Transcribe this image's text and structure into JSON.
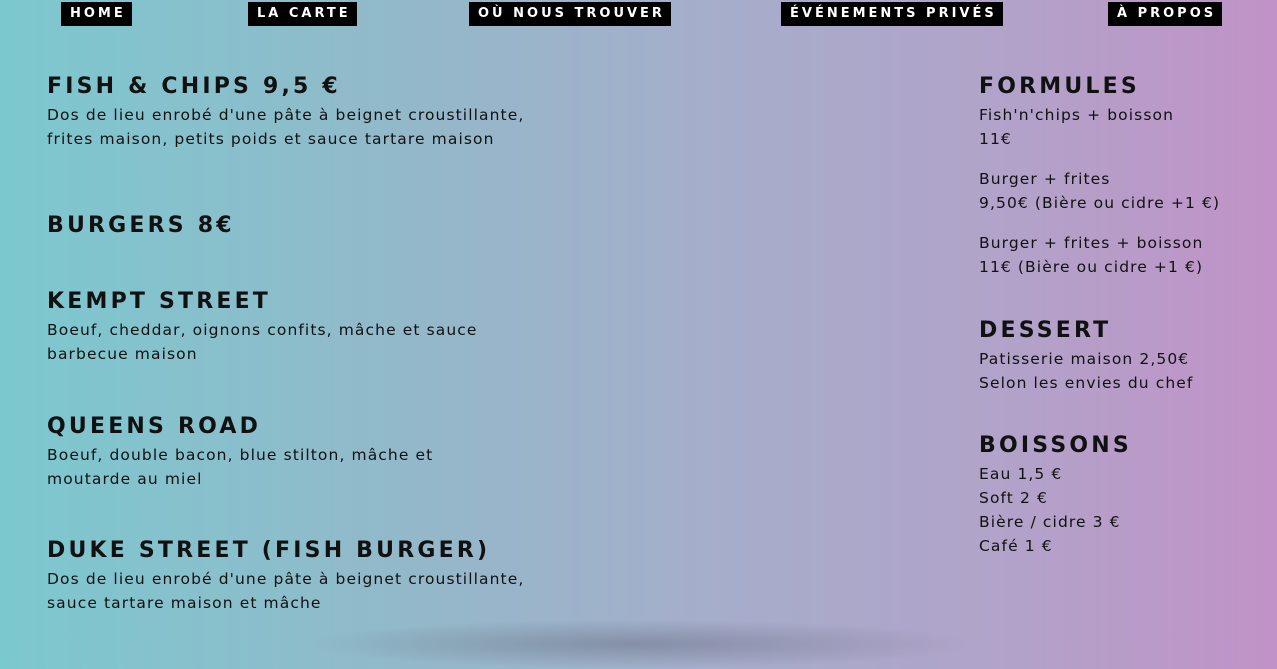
{
  "nav": {
    "home": "HOME",
    "carte": "LA CARTE",
    "trouver": "OÙ NOUS TROUVER",
    "events": "ÉVÉNEMENTS PRIVÉS",
    "propos": "À PROPOS"
  },
  "menu": {
    "fish": {
      "title": "FISH & CHIPS 9,5 €",
      "desc": "Dos de lieu enrobé d'une pâte à beignet croustillante, frites maison, petits poids et sauce tartare maison"
    },
    "burgers": {
      "title": "BURGERS 8€"
    },
    "kempt": {
      "title": "KEMPT STREET",
      "desc": "Boeuf, cheddar, oignons confits, mâche et sauce barbecue maison"
    },
    "queens": {
      "title": "QUEENS ROAD",
      "desc": "Boeuf, double bacon, blue stilton, mâche et moutarde au miel"
    },
    "duke": {
      "title": "DUKE STREET (FISH BURGER)",
      "desc": "Dos de lieu enrobé d'une pâte à beignet croustillante, sauce tartare maison et mâche"
    }
  },
  "formules": {
    "title": "FORMULES",
    "groups": [
      {
        "line1": "Fish'n'chips + boisson",
        "line2": "11€"
      },
      {
        "line1": "Burger + frites",
        "line2": "9,50€ (Bière ou cidre +1 €)"
      },
      {
        "line1": "Burger + frites + boisson",
        "line2": "11€ (Bière ou cidre +1 €)"
      }
    ]
  },
  "dessert": {
    "title": "DESSERT",
    "line1": "Patisserie maison 2,50€",
    "line2": "Selon les envies du chef"
  },
  "boissons": {
    "title": "BOISSONS",
    "items": [
      "Eau 1,5 €",
      "Soft 2 €",
      "Bière / cidre 3 €",
      "Café 1 €"
    ]
  }
}
